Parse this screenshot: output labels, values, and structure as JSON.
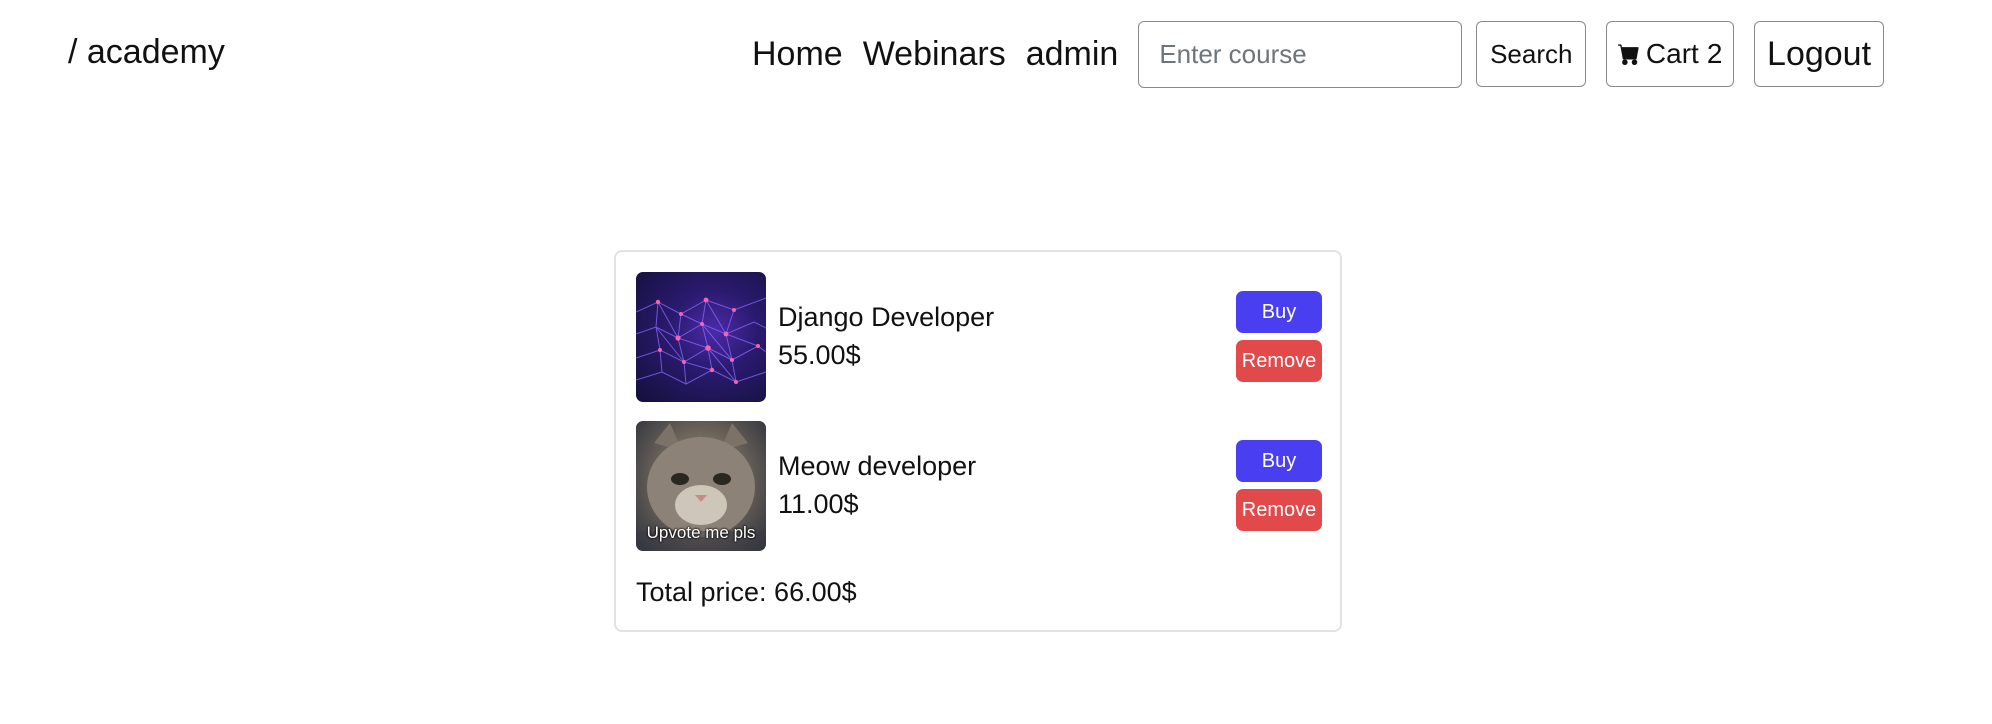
{
  "header": {
    "brand": "/ academy",
    "nav": {
      "home": "Home",
      "webinars": "Webinars",
      "user": "admin"
    },
    "search": {
      "placeholder": "Enter course",
      "button_label": "Search"
    },
    "cart": {
      "icon": "cart-icon",
      "label": "Cart",
      "count": "2"
    },
    "logout_label": "Logout"
  },
  "cart": {
    "items": [
      {
        "title": "Django Developer",
        "price": "55.00$",
        "image": "purple network mesh",
        "buy_label": "Buy",
        "remove_label": "Remove"
      },
      {
        "title": "Meow developer",
        "price": "11.00$",
        "image": "cat meme",
        "image_caption": "Upvote me pls",
        "buy_label": "Buy",
        "remove_label": "Remove"
      }
    ],
    "total_text": "Total price: 66.00$"
  },
  "colors": {
    "buy": "#4a3ff0",
    "remove": "#e2494a",
    "border": "#e2e2e2"
  }
}
